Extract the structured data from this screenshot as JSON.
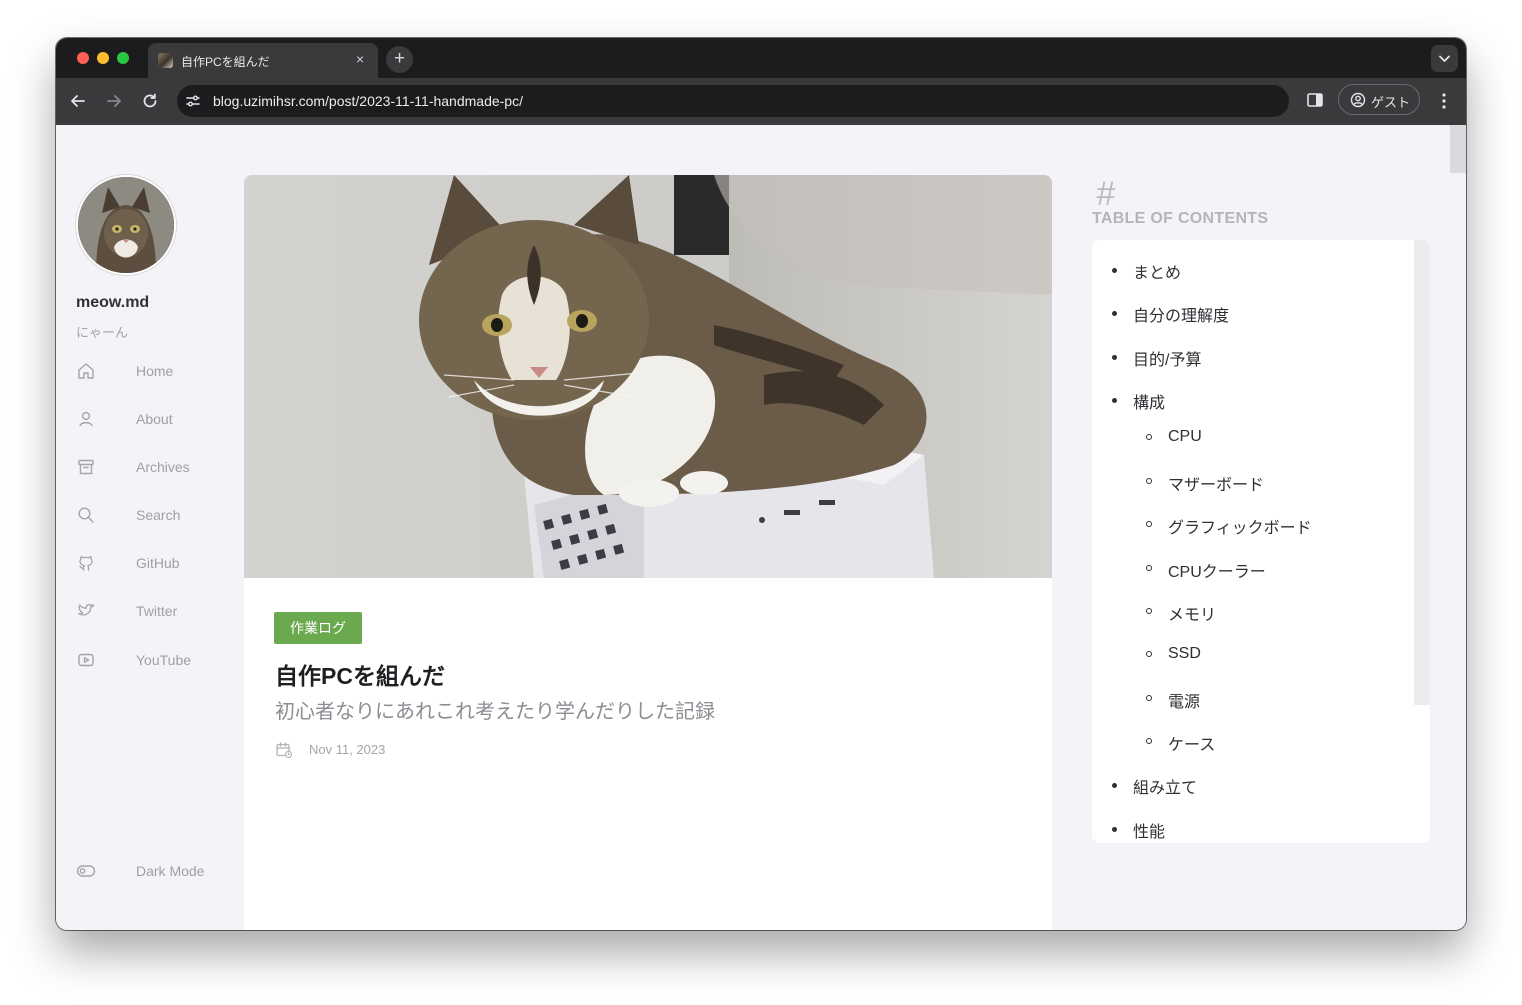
{
  "browser": {
    "tab": {
      "title": "自作PCを組んだ",
      "close": "×"
    },
    "new_tab": "+",
    "url": "blog.uzimihsr.com/post/2023-11-11-handmade-pc/",
    "profile_label": "ゲスト"
  },
  "sidebar": {
    "site_title": "meow.md",
    "site_subtitle": "にゃーん",
    "items": [
      {
        "label": "Home",
        "icon": "home-icon"
      },
      {
        "label": "About",
        "icon": "user-icon"
      },
      {
        "label": "Archives",
        "icon": "archive-icon"
      },
      {
        "label": "Search",
        "icon": "search-icon"
      },
      {
        "label": "GitHub",
        "icon": "github-icon"
      },
      {
        "label": "Twitter",
        "icon": "twitter-icon"
      },
      {
        "label": "YouTube",
        "icon": "youtube-icon"
      }
    ],
    "dark_mode_label": "Dark Mode"
  },
  "post": {
    "category": "作業ログ",
    "title": "自作PCを組んだ",
    "subtitle": "初心者なりにあれこれ考えたり学んだりした記録",
    "date": "Nov 11, 2023"
  },
  "toc": {
    "symbol": "#",
    "heading": "TABLE OF CONTENTS",
    "items": [
      {
        "label": "まとめ",
        "level": 1
      },
      {
        "label": "自分の理解度",
        "level": 1
      },
      {
        "label": "目的/予算",
        "level": 1
      },
      {
        "label": "構成",
        "level": 1
      },
      {
        "label": "CPU",
        "level": 2
      },
      {
        "label": "マザーボード",
        "level": 2
      },
      {
        "label": "グラフィックボード",
        "level": 2
      },
      {
        "label": "CPUクーラー",
        "level": 2
      },
      {
        "label": "メモリ",
        "level": 2
      },
      {
        "label": "SSD",
        "level": 2
      },
      {
        "label": "電源",
        "level": 2
      },
      {
        "label": "ケース",
        "level": 2
      },
      {
        "label": "組み立て",
        "level": 1
      },
      {
        "label": "性能",
        "level": 1
      }
    ]
  },
  "colors": {
    "accent_badge": "#6aa94e",
    "page_background": "#f3f3f8"
  }
}
